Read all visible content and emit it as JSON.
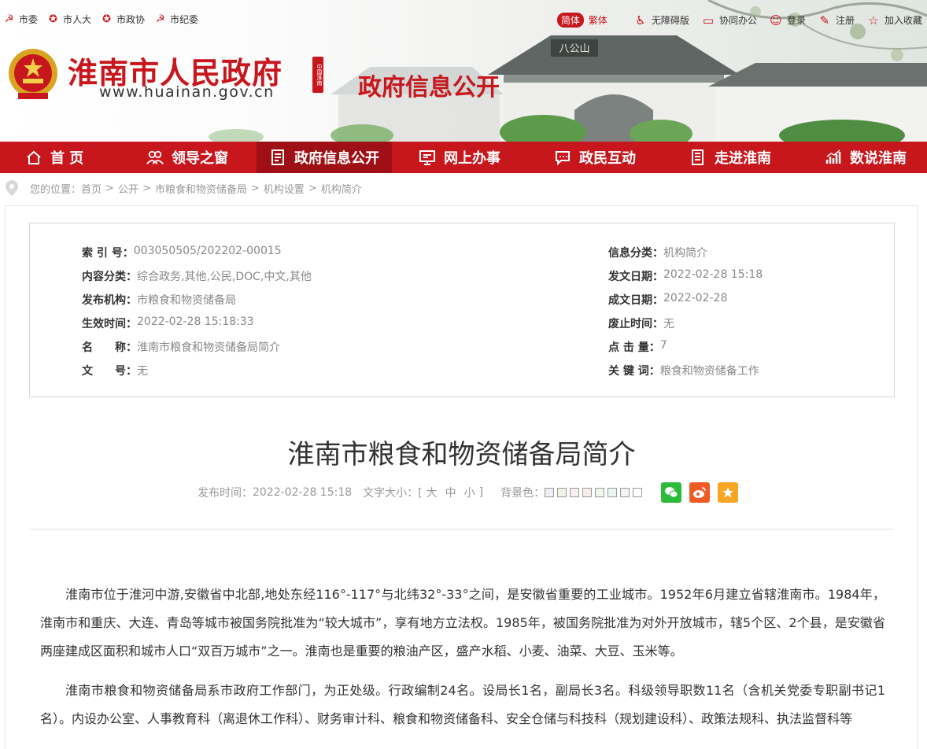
{
  "topbar": {
    "left_links": [
      "市委",
      "市人大",
      "市政协",
      "市纪委"
    ],
    "lang_simplified": "简体",
    "lang_traditional": "繁体",
    "right_links": [
      "无障碍版",
      "协同办公",
      "登录",
      "注册",
      "加入收藏"
    ]
  },
  "header": {
    "site_title": "淮南市人民政府",
    "site_url": "www.huainan.gov.cn",
    "seal_text": "中国淮南",
    "section_title": "政府信息公开",
    "scene_sign": "八公山"
  },
  "nav": {
    "items": [
      "首 页",
      "领导之窗",
      "政府信息公开",
      "网上办事",
      "政民互动",
      "走进淮南",
      "数说淮南"
    ]
  },
  "breadcrumb": {
    "prefix": "您的位置：",
    "items": [
      "首页",
      "公开",
      "市粮食和物资储备局",
      "机构设置",
      "机构简介"
    ],
    "separator": ">"
  },
  "meta": {
    "left": [
      {
        "label": "索 引 号：",
        "value": "003050505/202202-00015"
      },
      {
        "label": "内容分类：",
        "value": "综合政务,其他,公民,DOC,中文,其他"
      },
      {
        "label": "发布机构：",
        "value": "市粮食和物资储备局"
      },
      {
        "label": "生效时间：",
        "value": "2022-02-28 15:18:33"
      },
      {
        "label": "名　　称：",
        "value": "淮南市粮食和物资储备局简介"
      },
      {
        "label": "文　　号：",
        "value": "无"
      }
    ],
    "right": [
      {
        "label": "信息分类：",
        "value": "机构简介"
      },
      {
        "label": "发文日期：",
        "value": "2022-02-28 15:18"
      },
      {
        "label": "成文日期：",
        "value": "2022-02-28"
      },
      {
        "label": "废止时间：",
        "value": "无"
      },
      {
        "label": "点 击 量：",
        "value": "7"
      },
      {
        "label": "关 键 词：",
        "value": "粮食和物资储备工作"
      }
    ]
  },
  "article": {
    "title": "淮南市粮食和物资储备局简介",
    "publish_label": "发布时间：",
    "publish_time": "2022-02-28 15:18",
    "font_size_label": "文字大小：[",
    "font_sizes": [
      "大",
      "中",
      "小"
    ],
    "font_size_end": "]",
    "bg_label": "背景色：",
    "bg_colors": [
      "#eef0f6",
      "#f2f2e8",
      "#f8f0f0",
      "#fbecec",
      "#f1f6ec",
      "#ebf6f4",
      "#f3f3f3",
      "#ffffff"
    ],
    "paragraphs": [
      "淮南市位于淮河中游,安徽省中北部,地处东经116°-117°与北纬32°-33°之间，是安徽省重要的工业城市。1952年6月建立省辖淮南市。1984年，淮南市和重庆、大连、青岛等城市被国务院批准为“较大城市”，享有地方立法权。1985年，被国务院批准为对外开放城市，辖5个区、2个县，是安徽省两座建成区面积和城市人口“双百万城市”之一。淮南也是重要的粮油产区，盛产水稻、小麦、油菜、大豆、玉米等。",
      "淮南市粮食和物资储备局系市政府工作部门，为正处级。行政编制24名。设局长1名，副局长3名。科级领导职数11名（含机关党委专职副书记1名）。内设办公室、人事教育科（离退休工作科）、财务审计科、粮食和物资储备科、安全仓储与科技科（规划建设科）、政策法规科、执法监督科等"
    ]
  },
  "colors": {
    "brand_red": "#c8161d",
    "nav_active": "#9e1016",
    "wechat": "#2dbb3c",
    "weibo": "#f05a24",
    "favorite": "#f6a623"
  }
}
